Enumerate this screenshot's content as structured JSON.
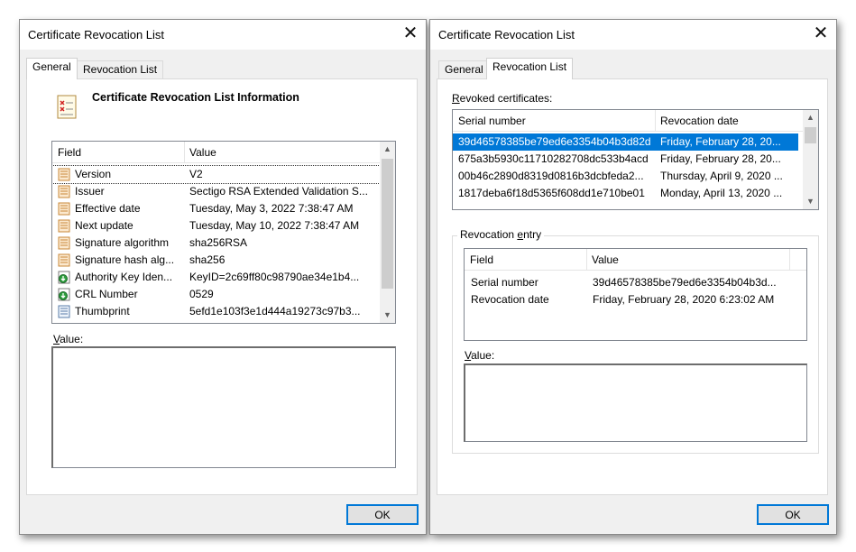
{
  "left_dialog": {
    "title": "Certificate Revocation List",
    "tabs": [
      "General",
      "Revocation List"
    ],
    "heading": "Certificate Revocation List Information",
    "columns": [
      "Field",
      "Value"
    ],
    "rows": [
      {
        "field": "Version",
        "value": "V2",
        "icon": "doc-field-icon"
      },
      {
        "field": "Issuer",
        "value": "Sectigo RSA Extended Validation S...",
        "icon": "doc-field-icon"
      },
      {
        "field": "Effective date",
        "value": "Tuesday, May 3, 2022 7:38:47 AM",
        "icon": "doc-field-icon"
      },
      {
        "field": "Next update",
        "value": "Tuesday, May 10, 2022 7:38:47 AM",
        "icon": "doc-field-icon"
      },
      {
        "field": "Signature algorithm",
        "value": "sha256RSA",
        "icon": "doc-field-icon"
      },
      {
        "field": "Signature hash alg...",
        "value": "sha256",
        "icon": "doc-field-icon"
      },
      {
        "field": "Authority Key Iden...",
        "value": "KeyID=2c69ff80c98790ae34e1b4...",
        "icon": "extension-icon"
      },
      {
        "field": "CRL Number",
        "value": "0529",
        "icon": "extension-icon"
      },
      {
        "field": "Thumbprint",
        "value": "5efd1e103f3e1d444a19273c97b3...",
        "icon": "thumbprint-icon"
      }
    ],
    "value_label_prefix": "V",
    "value_label_rest": "alue:",
    "ok_label": "OK"
  },
  "right_dialog": {
    "title": "Certificate Revocation List",
    "tabs": [
      "General",
      "Revocation List"
    ],
    "revoked_label_prefix": "R",
    "revoked_label_rest": "evoked certificates:",
    "columns": [
      "Serial number",
      "Revocation date"
    ],
    "rows": [
      {
        "serial": "39d46578385be79ed6e3354b04b3d82d",
        "date": "Friday, February 28, 20..."
      },
      {
        "serial": "675a3b5930c11710282708dc533b4acd",
        "date": "Friday, February 28, 20..."
      },
      {
        "serial": "00b46c2890d8319d0816b3dcbfeda2...",
        "date": "Thursday, April 9, 2020 ..."
      },
      {
        "serial": "1817deba6f18d5365f608dd1e710be01",
        "date": "Monday, April 13, 2020 ..."
      }
    ],
    "entry_group_prefix": "Revocation ",
    "entry_group_underline": "e",
    "entry_group_rest": "ntry",
    "entry_columns": [
      "Field",
      "Value"
    ],
    "entry_rows": [
      {
        "field": "Serial number",
        "value": "39d46578385be79ed6e3354b04b3d..."
      },
      {
        "field": "Revocation date",
        "value": "Friday, February 28, 2020 6:23:02 AM"
      }
    ],
    "value_label_prefix": "V",
    "value_label_rest": "alue:",
    "ok_label": "OK"
  },
  "colors": {
    "selection": "#0078d7",
    "focus": "#0078d7"
  }
}
